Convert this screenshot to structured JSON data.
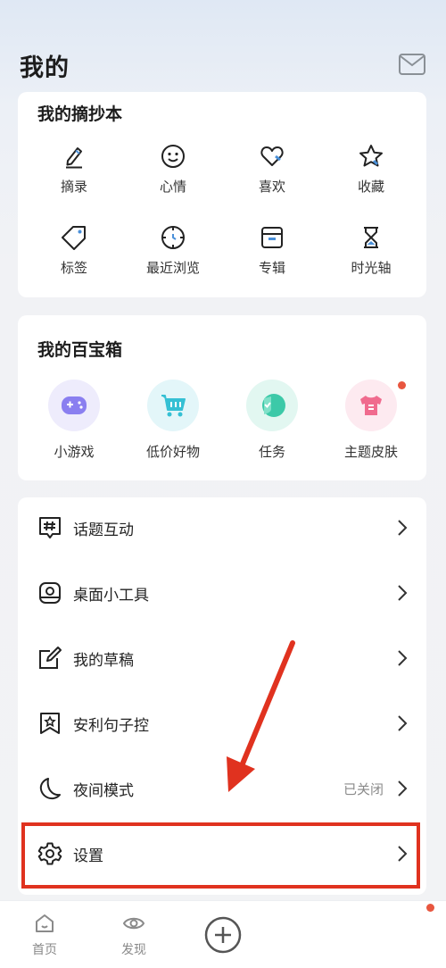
{
  "header": {
    "title": "我的"
  },
  "notebook": {
    "title": "我的摘抄本",
    "items": [
      {
        "label": "摘录",
        "icon": "pencil-icon"
      },
      {
        "label": "心情",
        "icon": "smiley-icon"
      },
      {
        "label": "喜欢",
        "icon": "heart-icon"
      },
      {
        "label": "收藏",
        "icon": "star-icon"
      },
      {
        "label": "标签",
        "icon": "tag-icon"
      },
      {
        "label": "最近浏览",
        "icon": "recent-clock-icon"
      },
      {
        "label": "专辑",
        "icon": "album-box-icon"
      },
      {
        "label": "时光轴",
        "icon": "hourglass-icon"
      }
    ]
  },
  "toolbox": {
    "title": "我的百宝箱",
    "items": [
      {
        "label": "小游戏",
        "icon": "gamepad-icon",
        "color": "#8a7ff0"
      },
      {
        "label": "低价好物",
        "icon": "shopping-cart-icon",
        "color": "#35c0d4"
      },
      {
        "label": "任务",
        "icon": "task-shield-icon",
        "color": "#3cc9a8"
      },
      {
        "label": "主题皮肤",
        "icon": "tshirt-icon",
        "color": "#f06b8e"
      }
    ]
  },
  "menu": {
    "items": [
      {
        "label": "话题互动",
        "icon": "hashtag-icon"
      },
      {
        "label": "桌面小工具",
        "icon": "widget-icon"
      },
      {
        "label": "我的草稿",
        "icon": "draft-edit-icon"
      },
      {
        "label": "安利句子控",
        "icon": "bookmark-star-icon"
      },
      {
        "label": "夜间模式",
        "icon": "moon-icon",
        "status": "已关闭"
      },
      {
        "label": "设置",
        "icon": "gear-icon"
      }
    ]
  },
  "bottom_nav": {
    "home": "首页",
    "discover": "发现"
  },
  "colors": {
    "highlight": "#e0321f",
    "badge": "#e8563f"
  }
}
